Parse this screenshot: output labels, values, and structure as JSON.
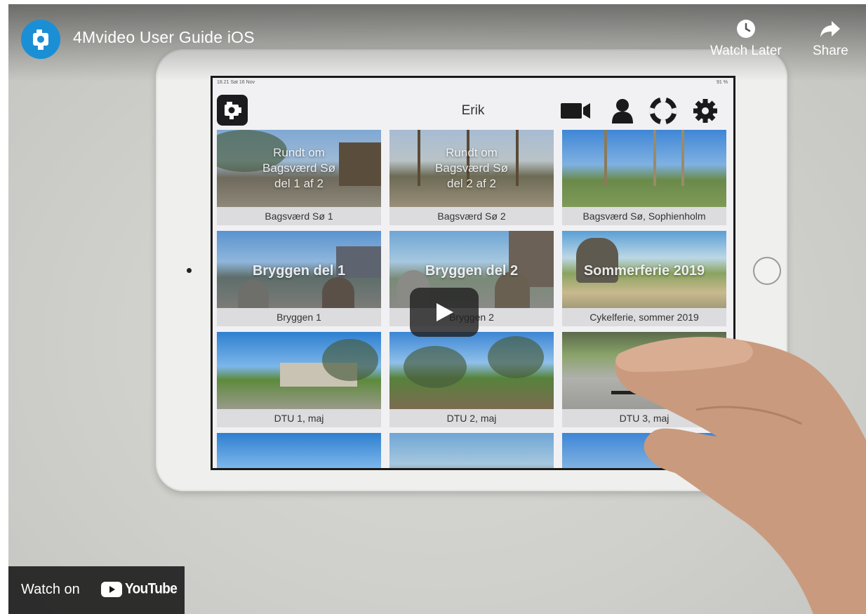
{
  "player": {
    "title": "4Mvideo User Guide iOS",
    "watch_later_label": "Watch Later",
    "share_label": "Share",
    "watch_on_label": "Watch on",
    "youtube_label": "YouTube",
    "colors": {
      "youtube_red": "#ff0000",
      "channel_blue": "#1a8fd6"
    }
  },
  "app": {
    "status_time": "18.21  Sat 16 Nov",
    "status_battery": "91 %",
    "user_name": "Erik",
    "nav_icons": [
      "video-camera-icon",
      "user-icon",
      "lifebuoy-icon",
      "gear-icon"
    ],
    "tiles": [
      {
        "caption": "Bagsværd Sø 1",
        "overlay_lines": [
          "Rundt om",
          "Bagsværd Sø",
          "del 1 af 2"
        ]
      },
      {
        "caption": "Bagsværd Sø 2",
        "overlay_lines": [
          "Rundt om",
          "Bagsværd Sø",
          "del 2 af 2"
        ]
      },
      {
        "caption": "Bagsværd Sø, Sophienholm",
        "overlay_lines": []
      },
      {
        "caption": "Bryggen 1",
        "overlay_lines": [
          "Bryggen del 1"
        ]
      },
      {
        "caption": "Bryggen 2",
        "overlay_lines": [
          "Bryggen del 2"
        ]
      },
      {
        "caption": "Cykelferie, sommer 2019",
        "overlay_lines": [
          "Sommerferie 2019"
        ]
      },
      {
        "caption": "DTU 1, maj",
        "overlay_lines": []
      },
      {
        "caption": "DTU 2, maj",
        "overlay_lines": []
      },
      {
        "caption": "DTU 3, maj",
        "overlay_lines": []
      }
    ]
  }
}
